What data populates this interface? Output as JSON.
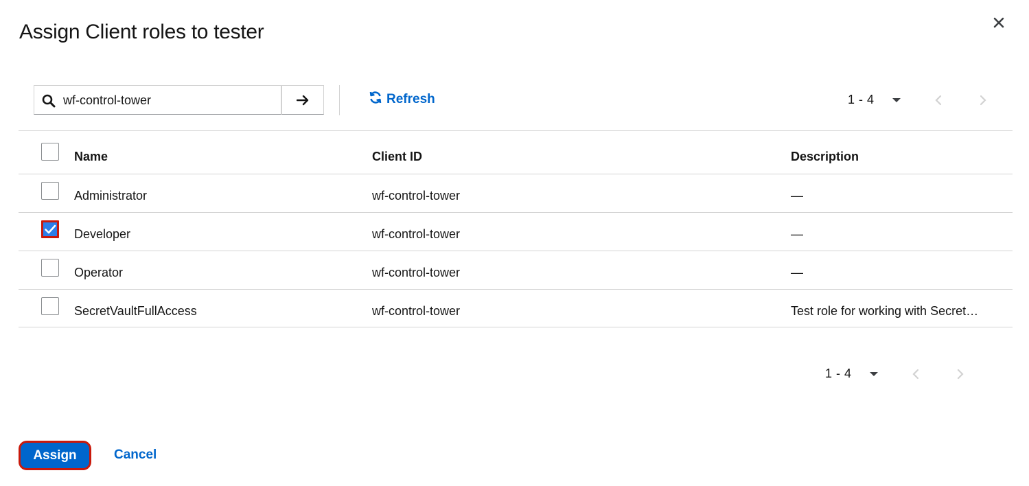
{
  "modal": {
    "title": "Assign Client roles to tester",
    "close_icon": "close-icon"
  },
  "toolbar": {
    "search_value": "wf-control-tower",
    "search_icon": "search-icon",
    "clear_icon": "clear-icon",
    "go_icon": "arrow-right-icon",
    "refresh_label": "Refresh",
    "refresh_icon": "sync-icon"
  },
  "pagination_top": {
    "range": "1 - 4"
  },
  "pagination_bottom": {
    "range": "1 - 4"
  },
  "table": {
    "columns": [
      "Name",
      "Client ID",
      "Description"
    ],
    "rows": [
      {
        "name": "Administrator",
        "client_id": "wf-control-tower",
        "description": "—",
        "checked": false
      },
      {
        "name": "Developer",
        "client_id": "wf-control-tower",
        "description": "—",
        "checked": true
      },
      {
        "name": "Operator",
        "client_id": "wf-control-tower",
        "description": "—",
        "checked": false
      },
      {
        "name": "SecretVaultFullAccess",
        "client_id": "wf-control-tower",
        "description": "Test role for working with Secret…",
        "checked": false
      }
    ]
  },
  "footer": {
    "assign_label": "Assign",
    "cancel_label": "Cancel"
  },
  "colors": {
    "primary": "#0066cc",
    "highlight": "#c9190b",
    "checkbox_fill": "#2b7de9"
  }
}
